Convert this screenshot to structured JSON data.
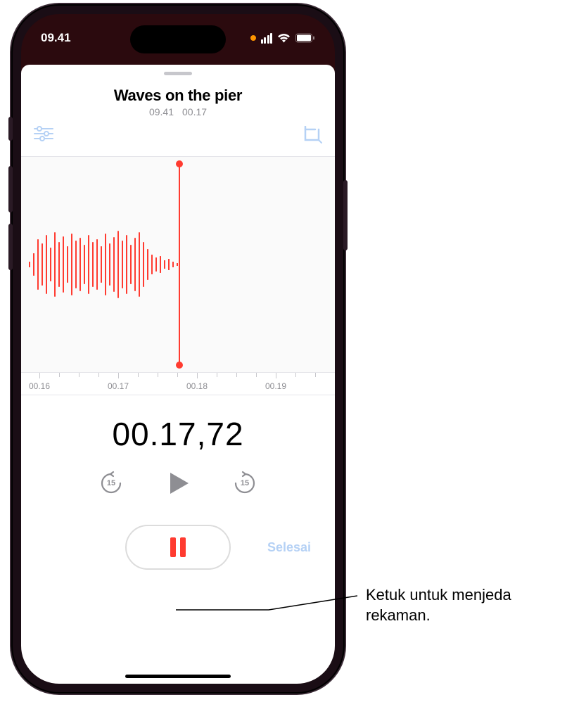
{
  "status": {
    "time": "09.41"
  },
  "recording": {
    "title": "Waves on the pier",
    "meta_time": "09.41",
    "meta_dur": "00.17"
  },
  "ruler": {
    "t1": "00.16",
    "t2": "00.17",
    "t3": "00.18",
    "t4": "00.19"
  },
  "current_time": "00.17,72",
  "skip_back": "15",
  "skip_fwd": "15",
  "done_label": "Selesai",
  "callout": {
    "line1": "Ketuk untuk menjeda",
    "line2": "rekaman."
  }
}
